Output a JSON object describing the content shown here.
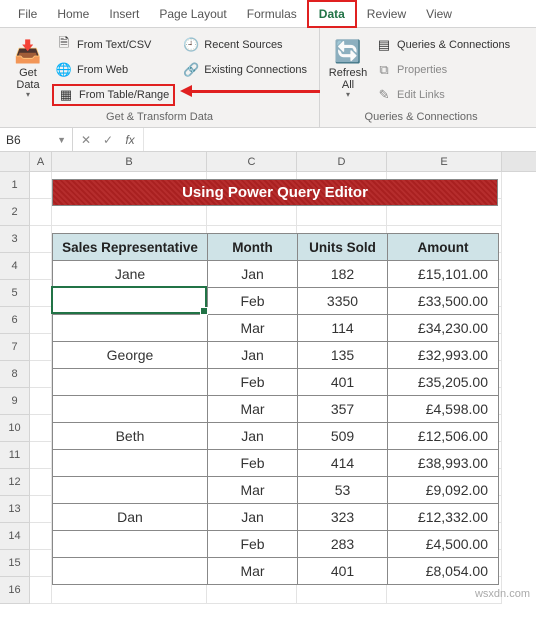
{
  "tabs": {
    "file": "File",
    "home": "Home",
    "insert": "Insert",
    "pagelayout": "Page Layout",
    "formulas": "Formulas",
    "data": "Data",
    "review": "Review",
    "view": "View"
  },
  "ribbon": {
    "getdata": "Get Data",
    "fromtextcsv": "From Text/CSV",
    "fromweb": "From Web",
    "fromtablerange": "From Table/Range",
    "recentsources": "Recent Sources",
    "existingconnections": "Existing Connections",
    "refreshall": "Refresh All",
    "queriesconnections": "Queries & Connections",
    "properties": "Properties",
    "editlinks": "Edit Links",
    "group1": "Get & Transform Data",
    "group2": "Queries & Connections"
  },
  "namebox": "B6",
  "colheaders": {
    "A": "A",
    "B": "B",
    "C": "C",
    "D": "D",
    "E": "E"
  },
  "title_banner": "Using Power Query Editor",
  "table": {
    "headers": {
      "rep": "Sales Representative",
      "month": "Month",
      "units": "Units Sold",
      "amount": "Amount"
    },
    "rows": [
      {
        "rep": "Jane",
        "month": "Jan",
        "units": "182",
        "amount": "£15,101.00"
      },
      {
        "rep": "",
        "month": "Feb",
        "units": "3350",
        "amount": "£33,500.00"
      },
      {
        "rep": "",
        "month": "Mar",
        "units": "114",
        "amount": "£34,230.00"
      },
      {
        "rep": "George",
        "month": "Jan",
        "units": "135",
        "amount": "£32,993.00"
      },
      {
        "rep": "",
        "month": "Feb",
        "units": "401",
        "amount": "£35,205.00"
      },
      {
        "rep": "",
        "month": "Mar",
        "units": "357",
        "amount": "£4,598.00"
      },
      {
        "rep": "Beth",
        "month": "Jan",
        "units": "509",
        "amount": "£12,506.00"
      },
      {
        "rep": "",
        "month": "Feb",
        "units": "414",
        "amount": "£38,993.00"
      },
      {
        "rep": "",
        "month": "Mar",
        "units": "53",
        "amount": "£9,092.00"
      },
      {
        "rep": "Dan",
        "month": "Jan",
        "units": "323",
        "amount": "£12,332.00"
      },
      {
        "rep": "",
        "month": "Feb",
        "units": "283",
        "amount": "£4,500.00"
      },
      {
        "rep": "",
        "month": "Mar",
        "units": "401",
        "amount": "£8,054.00"
      }
    ]
  },
  "watermark": "wsxdn.com"
}
